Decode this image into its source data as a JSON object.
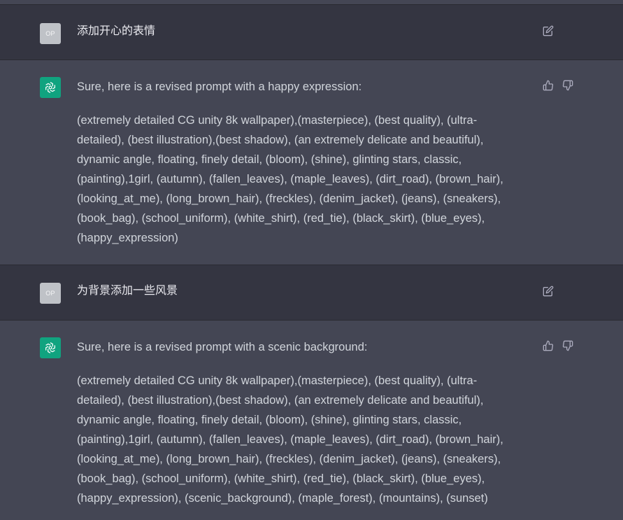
{
  "user_avatar_initials": "OP",
  "messages": [
    {
      "role": "user",
      "text": "添加开心的表情"
    },
    {
      "role": "assistant",
      "intro": "Sure, here is a revised prompt with a happy expression:",
      "body_lines": [
        "(extremely detailed CG unity 8k wallpaper),(masterpiece), (best quality), (ultra-",
        "detailed), (best illustration),(best shadow), (an extremely delicate and beautiful),",
        "dynamic angle, floating, finely detail, (bloom), (shine), glinting stars, classic,",
        "(painting),1girl, (autumn), (fallen_leaves), (maple_leaves), (dirt_road), (brown_hair),",
        "(looking_at_me), (long_brown_hair), (freckles), (denim_jacket), (jeans), (sneakers),",
        "(book_bag), (school_uniform), (white_shirt), (red_tie), (black_skirt), (blue_eyes),",
        "(happy_expression)"
      ]
    },
    {
      "role": "user",
      "text": "为背景添加一些风景"
    },
    {
      "role": "assistant",
      "intro": "Sure, here is a revised prompt with a scenic background:",
      "body_lines": [
        "(extremely detailed CG unity 8k wallpaper),(masterpiece), (best quality), (ultra-",
        "detailed), (best illustration),(best shadow), (an extremely delicate and beautiful),",
        "dynamic angle, floating, finely detail, (bloom), (shine), glinting stars, classic,",
        "(painting),1girl, (autumn), (fallen_leaves), (maple_leaves), (dirt_road), (brown_hair),",
        "(looking_at_me), (long_brown_hair), (freckles), (denim_jacket), (jeans), (sneakers),",
        "(book_bag), (school_uniform), (white_shirt), (red_tie), (black_skirt), (blue_eyes),",
        "(happy_expression), (scenic_background), (maple_forest), (mountains), (sunset)"
      ]
    }
  ],
  "icons": {
    "edit": "edit-icon",
    "thumbs_up": "thumbs-up-icon",
    "thumbs_down": "thumbs-down-icon",
    "assistant_logo": "openai-logo-icon"
  },
  "colors": {
    "user_row_bg": "#343541",
    "assistant_row_bg": "#444654",
    "assistant_avatar_bg": "#10a37f",
    "user_avatar_bg": "#bfc2c7",
    "text": "#d1d5db",
    "icon": "#acacbe"
  }
}
